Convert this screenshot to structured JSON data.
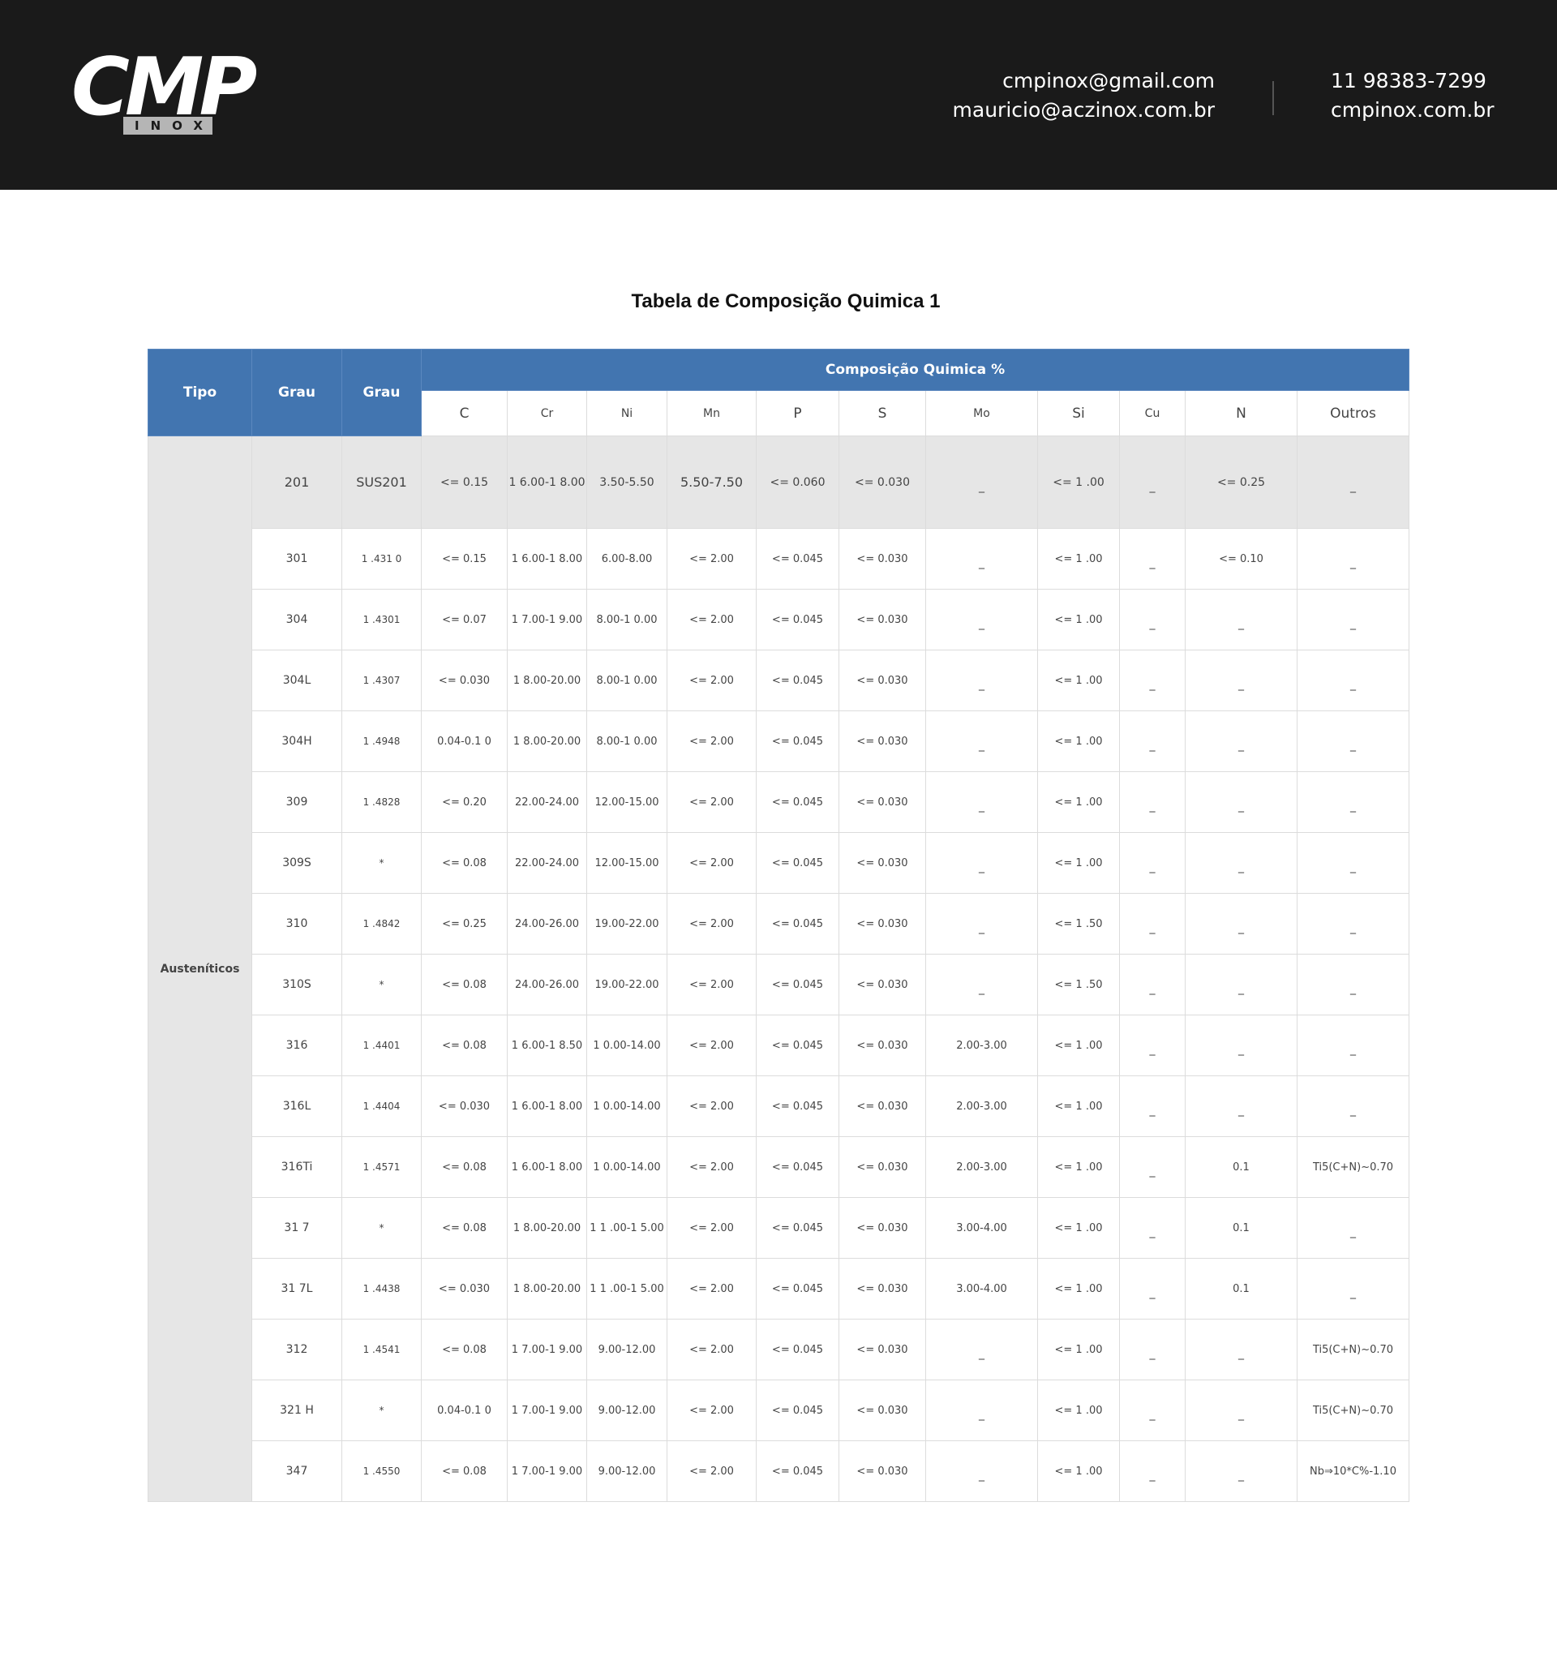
{
  "header": {
    "logo": {
      "main": "CMP",
      "sub": "INOX"
    },
    "emails": [
      "cmpinox@gmail.com",
      "mauricio@aczinox.com.br"
    ],
    "phone": "11 98383-7299",
    "website": "cmpinox.com.br"
  },
  "title": "Tabela de Composição Quimica 1",
  "table": {
    "head": {
      "tipo": "Tipo",
      "grau1": "Grau",
      "grau2": "Grau",
      "composicao": "Composição Quimica %",
      "elements": [
        "C",
        "Cr",
        "Ni",
        "Mn",
        "P",
        "S",
        "Mo",
        "Si",
        "Cu",
        "N",
        "Outros"
      ]
    },
    "group": "Austeníticos",
    "rows": [
      [
        "201",
        "SUS201",
        "<= 0.15",
        "1 6.00-1 8.00",
        "3.50-5.50",
        "5.50-7.50",
        "<= 0.060",
        "<= 0.030",
        "_",
        "<= 1 .00",
        "_",
        "<= 0.25",
        "_"
      ],
      [
        "301",
        "1 .431 0",
        "<= 0.15",
        "1 6.00-1 8.00",
        "6.00-8.00",
        "<= 2.00",
        "<= 0.045",
        "<= 0.030",
        "_",
        "<= 1 .00",
        "_",
        "<= 0.10",
        "_"
      ],
      [
        "304",
        "1 .4301",
        "<= 0.07",
        "1 7.00-1 9.00",
        "8.00-1 0.00",
        "<= 2.00",
        "<= 0.045",
        "<= 0.030",
        "_",
        "<= 1 .00",
        "_",
        "_",
        "_"
      ],
      [
        "304L",
        "1 .4307",
        "<= 0.030",
        "1 8.00-20.00",
        "8.00-1 0.00",
        "<= 2.00",
        "<= 0.045",
        "<= 0.030",
        "_",
        "<= 1 .00",
        "_",
        "_",
        "_"
      ],
      [
        "304H",
        "1 .4948",
        "0.04-0.1 0",
        "1 8.00-20.00",
        "8.00-1 0.00",
        "<= 2.00",
        "<= 0.045",
        "<= 0.030",
        "_",
        "<= 1 .00",
        "_",
        "_",
        "_"
      ],
      [
        "309",
        "1 .4828",
        "<= 0.20",
        "22.00-24.00",
        "12.00-15.00",
        "<= 2.00",
        "<= 0.045",
        "<= 0.030",
        "_",
        "<= 1 .00",
        "_",
        "_",
        "_"
      ],
      [
        "309S",
        "*",
        "<= 0.08",
        "22.00-24.00",
        "12.00-15.00",
        "<= 2.00",
        "<= 0.045",
        "<= 0.030",
        "_",
        "<= 1 .00",
        "_",
        "_",
        "_"
      ],
      [
        "310",
        "1 .4842",
        "<= 0.25",
        "24.00-26.00",
        "19.00-22.00",
        "<= 2.00",
        "<= 0.045",
        "<= 0.030",
        "_",
        "<= 1 .50",
        "_",
        "_",
        "_"
      ],
      [
        "310S",
        "*",
        "<= 0.08",
        "24.00-26.00",
        "19.00-22.00",
        "<= 2.00",
        "<= 0.045",
        "<= 0.030",
        "_",
        "<= 1 .50",
        "_",
        "_",
        "_"
      ],
      [
        "316",
        "1 .4401",
        "<= 0.08",
        "1 6.00-1 8.50",
        "1 0.00-14.00",
        "<= 2.00",
        "<= 0.045",
        "<= 0.030",
        "2.00-3.00",
        "<= 1 .00",
        "_",
        "_",
        "_"
      ],
      [
        "316L",
        "1 .4404",
        "<= 0.030",
        "1 6.00-1 8.00",
        "1 0.00-14.00",
        "<= 2.00",
        "<= 0.045",
        "<= 0.030",
        "2.00-3.00",
        "<= 1 .00",
        "_",
        "_",
        "_"
      ],
      [
        "316Ti",
        "1 .4571",
        "<= 0.08",
        "1 6.00-1 8.00",
        "1 0.00-14.00",
        "<= 2.00",
        "<= 0.045",
        "<= 0.030",
        "2.00-3.00",
        "<= 1 .00",
        "_",
        "0.1",
        "Ti5(C+N)~0.70"
      ],
      [
        "31 7",
        "*",
        "<= 0.08",
        "1 8.00-20.00",
        "1 1 .00-1 5.00",
        "<= 2.00",
        "<= 0.045",
        "<= 0.030",
        "3.00-4.00",
        "<= 1 .00",
        "_",
        "0.1",
        "_"
      ],
      [
        "31 7L",
        "1 .4438",
        "<= 0.030",
        "1 8.00-20.00",
        "1 1 .00-1 5.00",
        "<= 2.00",
        "<= 0.045",
        "<= 0.030",
        "3.00-4.00",
        "<= 1 .00",
        "_",
        "0.1",
        "_"
      ],
      [
        "312",
        "1 .4541",
        "<= 0.08",
        "1 7.00-1 9.00",
        "9.00-12.00",
        "<= 2.00",
        "<= 0.045",
        "<= 0.030",
        "_",
        "<= 1 .00",
        "_",
        "_",
        "Ti5(C+N)~0.70"
      ],
      [
        "321 H",
        "*",
        "0.04-0.1 0",
        "1 7.00-1 9.00",
        "9.00-12.00",
        "<= 2.00",
        "<= 0.045",
        "<= 0.030",
        "_",
        "<= 1 .00",
        "_",
        "_",
        "Ti5(C+N)~0.70"
      ],
      [
        "347",
        "1 .4550",
        "<= 0.08",
        "1 7.00-1 9.00",
        "9.00-12.00",
        "<= 2.00",
        "<= 0.045",
        "<= 0.030",
        "_",
        "<= 1 .00",
        "_",
        "_",
        "Nb⇒10*C%-1.10"
      ]
    ]
  },
  "colors": {
    "header_bg": "#1a1a1a",
    "table_header": "#4275b0",
    "group_bg": "#e5e5e5"
  }
}
